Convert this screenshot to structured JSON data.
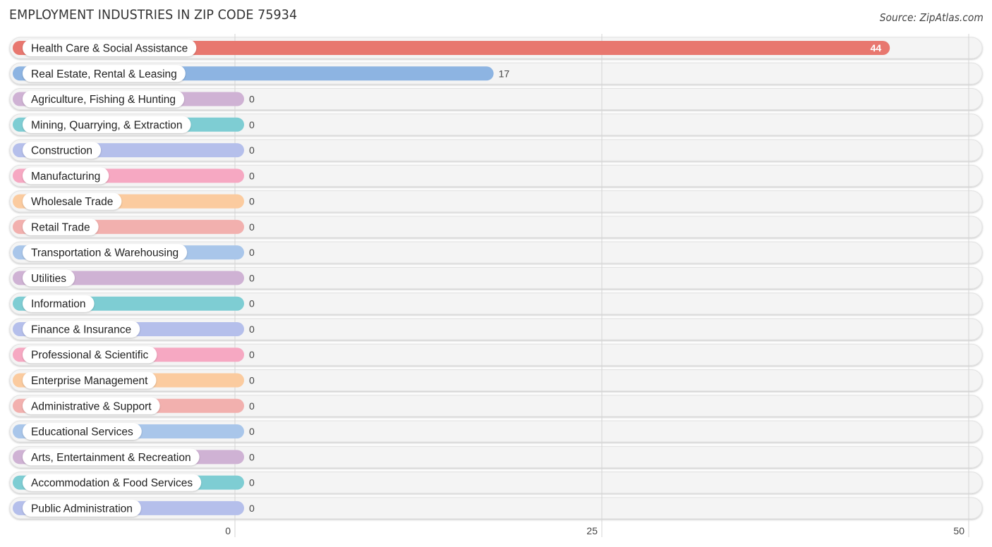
{
  "header": {
    "title": "EMPLOYMENT INDUSTRIES IN ZIP CODE 75934",
    "source": "Source: ZipAtlas.com"
  },
  "chart_data": {
    "type": "bar",
    "orientation": "horizontal",
    "title": "EMPLOYMENT INDUSTRIES IN ZIP CODE 75934",
    "xlabel": "",
    "ylabel": "",
    "xlim": [
      0,
      50
    ],
    "x_ticks": [
      0,
      25,
      50
    ],
    "grid": true,
    "categories": [
      "Health Care & Social Assistance",
      "Real Estate, Rental & Leasing",
      "Agriculture, Fishing & Hunting",
      "Mining, Quarrying, & Extraction",
      "Construction",
      "Manufacturing",
      "Wholesale Trade",
      "Retail Trade",
      "Transportation & Warehousing",
      "Utilities",
      "Information",
      "Finance & Insurance",
      "Professional & Scientific",
      "Enterprise Management",
      "Administrative & Support",
      "Educational Services",
      "Arts, Entertainment & Recreation",
      "Accommodation & Food Services",
      "Public Administration"
    ],
    "values": [
      44,
      17,
      0,
      0,
      0,
      0,
      0,
      0,
      0,
      0,
      0,
      0,
      0,
      0,
      0,
      0,
      0,
      0,
      0
    ],
    "colors": [
      "#e8776f",
      "#8db4e2",
      "#cfb2d4",
      "#7ecdd3",
      "#b5bfeb",
      "#f6a8c2",
      "#fbcb9f",
      "#f2b0ae",
      "#a9c6ea",
      "#cfb2d4",
      "#7ecdd3",
      "#b5bfeb",
      "#f6a8c2",
      "#fbcb9f",
      "#f2b0ae",
      "#a9c6ea",
      "#cfb2d4",
      "#7ecdd3",
      "#b5bfeb"
    ]
  }
}
